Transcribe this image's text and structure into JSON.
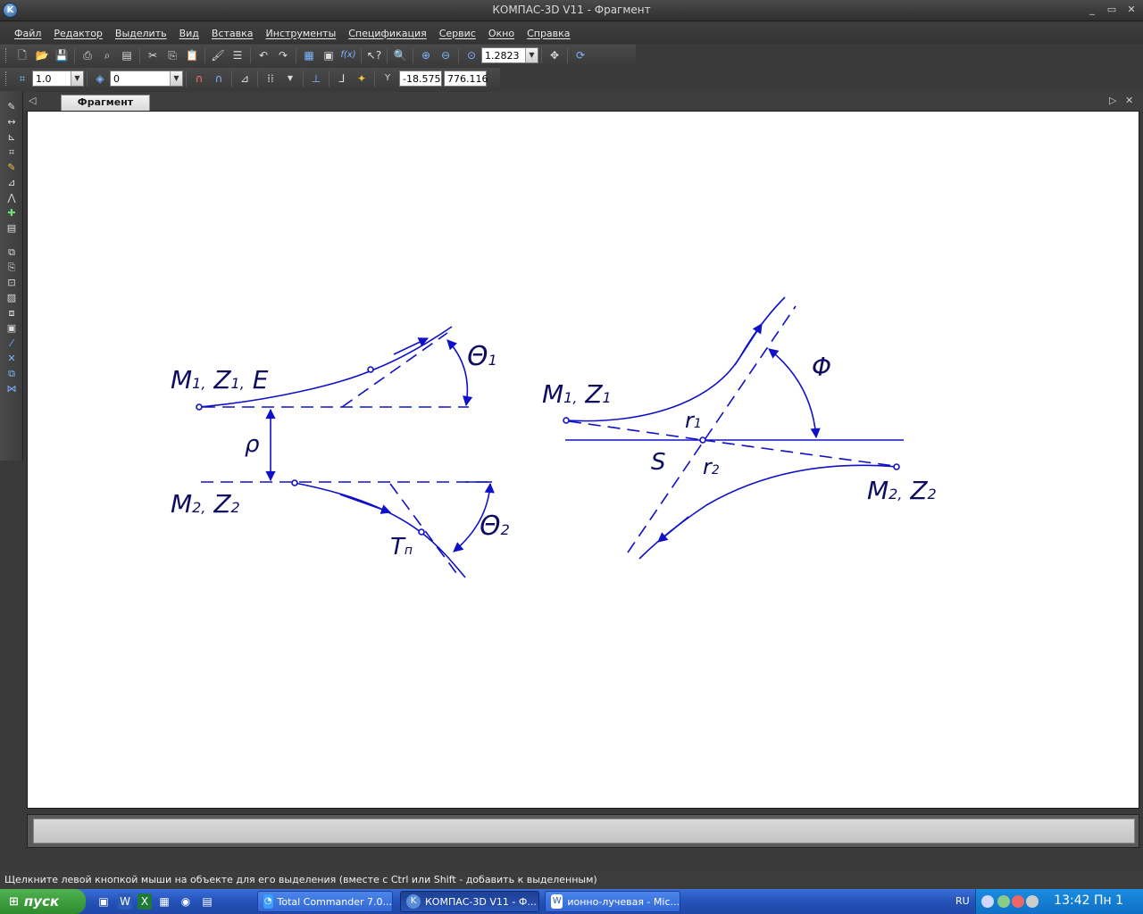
{
  "window": {
    "title": "КОМПАС-3D V11 - Фрагмент",
    "controls": {
      "minimize": "_",
      "maximize": "▭",
      "close": "✕"
    }
  },
  "menu": {
    "items": [
      "Файл",
      "Редактор",
      "Выделить",
      "Вид",
      "Вставка",
      "Инструменты",
      "Спецификация",
      "Сервис",
      "Окно",
      "Справка"
    ]
  },
  "toolbar1": {
    "zoom_value": "1.2823",
    "fx_label": "f(x)"
  },
  "toolbar2": {
    "step_value": "1.0",
    "layer_value": "0",
    "coord_label": "Y",
    "coord_x": "-18.575",
    "coord_y": "776.116"
  },
  "document": {
    "tab_label": "Фрагмент"
  },
  "drawing": {
    "left": {
      "label_top": "M1, Z1, E",
      "label_top_parts": [
        "M",
        "1,",
        " Z",
        "1,",
        " E"
      ],
      "label_bottom_parts": [
        "M",
        "2,",
        " Z",
        "2"
      ],
      "theta1": [
        "Θ",
        "1"
      ],
      "theta2": [
        "Θ",
        "2"
      ],
      "rho": "ρ",
      "tangent": [
        "T",
        "п"
      ]
    },
    "right": {
      "m1_parts": [
        "M",
        "1,",
        " Z",
        "1"
      ],
      "m2_parts": [
        "M",
        "2,",
        " Z",
        "2"
      ],
      "phi": "Φ",
      "r1": [
        "r",
        "1"
      ],
      "r2": [
        "r",
        "2"
      ],
      "s": "S"
    },
    "line_color": "#1010c8"
  },
  "status": {
    "hint": "Щелкните левой кнопкой мыши на объекте для его выделения (вместе с Ctrl или Shift - добавить к выделенным)"
  },
  "taskbar": {
    "start_label": "пуск",
    "tasks": [
      {
        "label": "Total Commander 7.0...",
        "active": false
      },
      {
        "label": "КОМПАС-3D V11 - Ф...",
        "active": true
      },
      {
        "label": "ионно-лучевая - Mic...",
        "active": false
      }
    ],
    "language": "RU",
    "clock": "13:42 Пн 1"
  }
}
